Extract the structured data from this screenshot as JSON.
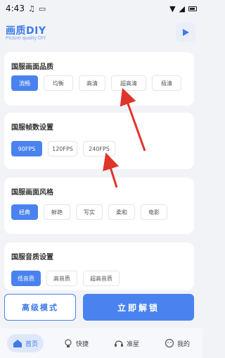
{
  "status_bar": {
    "time": "4:43"
  },
  "header": {
    "title": "画质DIY",
    "subtitle": "Picture quality DIY"
  },
  "sections": [
    {
      "title": "国服画面品质",
      "options": [
        "流畅",
        "均衡",
        "高清",
        "超高清",
        "极清"
      ],
      "selected": "流畅"
    },
    {
      "title": "国服帧数设置",
      "options": [
        "90FPS",
        "120FPS",
        "240FPS"
      ],
      "selected": "90FPS"
    },
    {
      "title": "国服画面风格",
      "options": [
        "经典",
        "鲜艳",
        "写实",
        "柔和",
        "电影"
      ],
      "selected": "经典"
    },
    {
      "title": "国服音质设置",
      "options": [
        "低音质",
        "高音质",
        "超高音质"
      ],
      "selected": "低音质"
    }
  ],
  "actions": {
    "advanced": "高级模式",
    "unlock": "立即解锁"
  },
  "nav": [
    {
      "label": "首页",
      "icon": "home-icon",
      "active": true
    },
    {
      "label": "快捷",
      "icon": "bulb-icon",
      "active": false
    },
    {
      "label": "准星",
      "icon": "headset-icon",
      "active": false
    },
    {
      "label": "我的",
      "icon": "smile-icon",
      "active": false
    }
  ],
  "colors": {
    "accent": "#4a83ef",
    "annotation_arrow": "#e0352b"
  }
}
